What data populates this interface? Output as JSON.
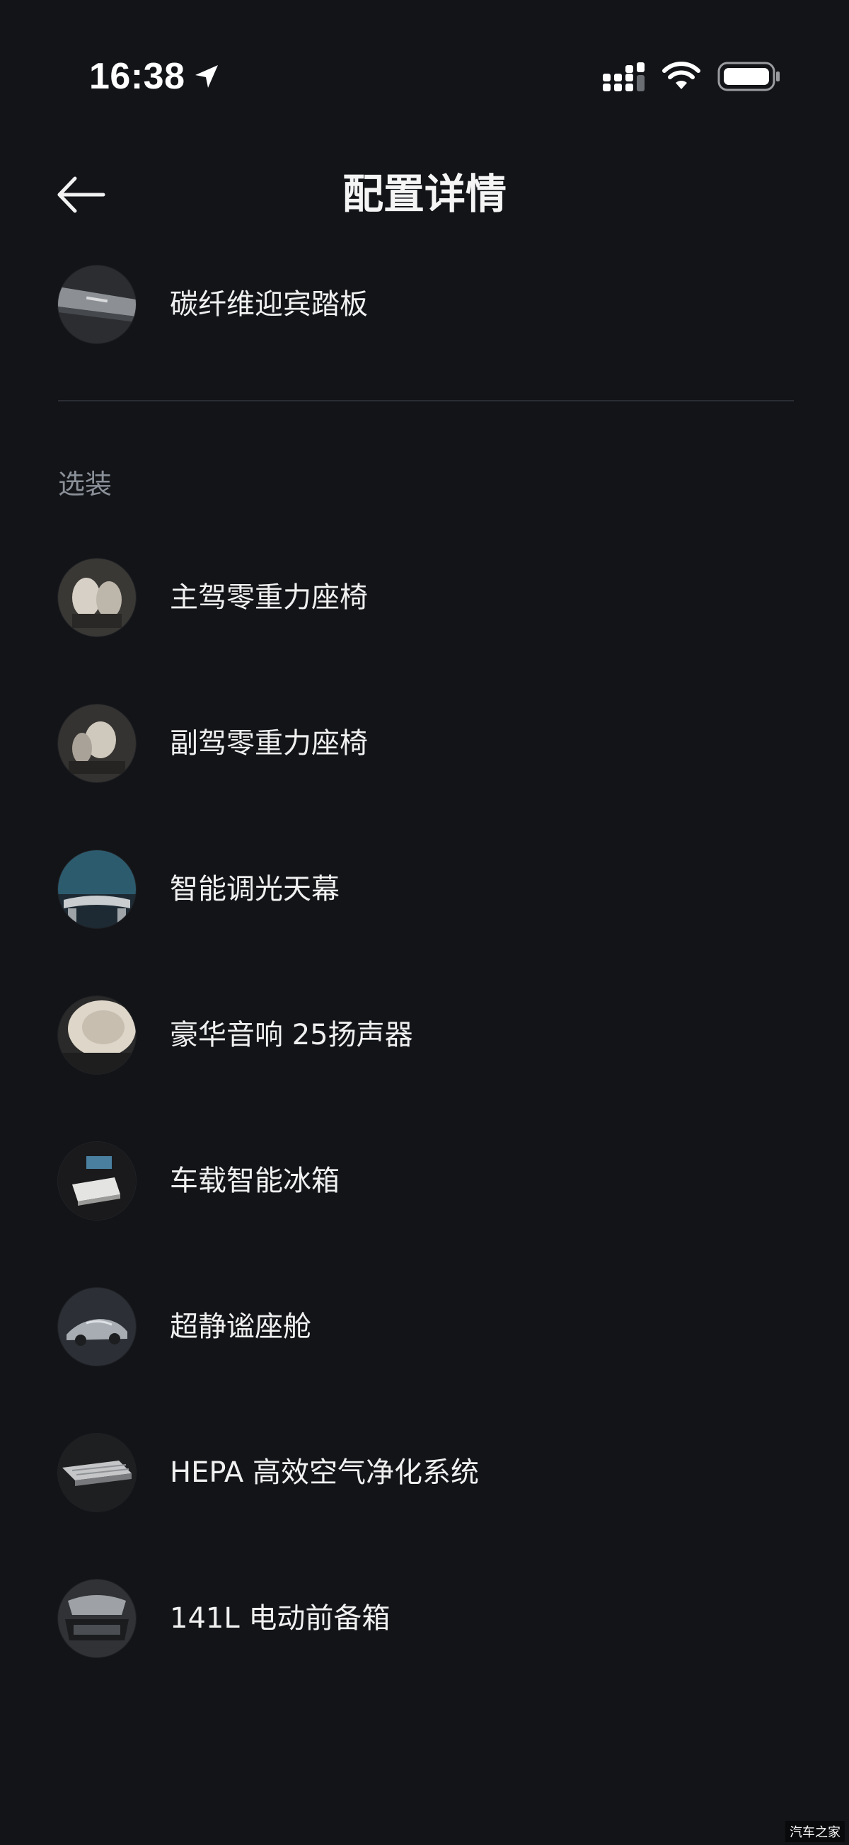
{
  "status_bar": {
    "time": "16:38",
    "icons": [
      "location-arrow-icon",
      "cellular-signal-icon",
      "wifi-icon",
      "battery-icon"
    ]
  },
  "header": {
    "title": "配置详情",
    "back_icon": "arrow-left-icon"
  },
  "standard_items": [
    {
      "label": "碳纤维迎宾踏板",
      "thumb": "sill-plate"
    }
  ],
  "optional_section": {
    "title": "选装",
    "items": [
      {
        "label": "主驾零重力座椅",
        "thumb": "seat"
      },
      {
        "label": "副驾零重力座椅",
        "thumb": "seat"
      },
      {
        "label": "智能调光天幕",
        "thumb": "roof"
      },
      {
        "label": "豪华音响 25扬声器",
        "thumb": "speaker"
      },
      {
        "label": "车载智能冰箱",
        "thumb": "fridge"
      },
      {
        "label": "超静谧座舱",
        "thumb": "car"
      },
      {
        "label": "HEPA 高效空气净化系统",
        "thumb": "filter"
      },
      {
        "label": "141L 电动前备箱",
        "thumb": "frunk"
      }
    ]
  },
  "watermark": "汽车之家",
  "colors": {
    "background": "#121418",
    "text": "#f0f0f0",
    "section_label": "#8b9098",
    "divider": "#2a2d33"
  }
}
